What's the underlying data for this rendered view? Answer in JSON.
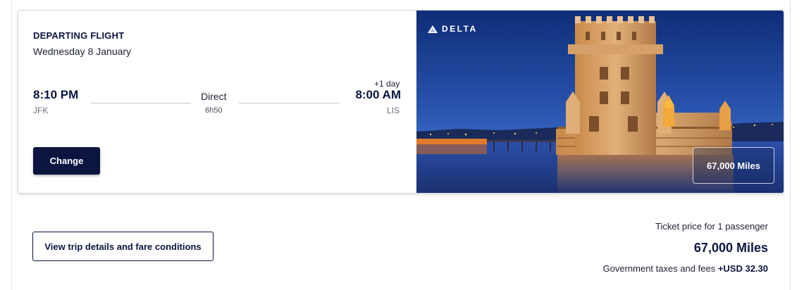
{
  "flight": {
    "heading": "DEPARTING FLIGHT",
    "date": "Wednesday 8 January",
    "departure": {
      "time": "8:10 PM",
      "airport": "JFK"
    },
    "arrival": {
      "time": "8:00 AM",
      "airport": "LIS",
      "day_offset": "+1 day"
    },
    "stops": "Direct",
    "duration": "6h50",
    "change_label": "Change"
  },
  "promo": {
    "airline": "DELTA",
    "miles": "67,000 Miles",
    "icon": "delta-logo-icon"
  },
  "summary": {
    "details_label": "View trip details and fare conditions",
    "ticket_label": "Ticket price for 1 passenger",
    "price": "67,000 Miles",
    "taxes_label": "Government taxes and fees",
    "taxes_value": "+USD 32.30"
  },
  "colors": {
    "primary": "#0b1540",
    "sky_top": "#1a3a8a",
    "stone_lit": "#d9a466"
  }
}
